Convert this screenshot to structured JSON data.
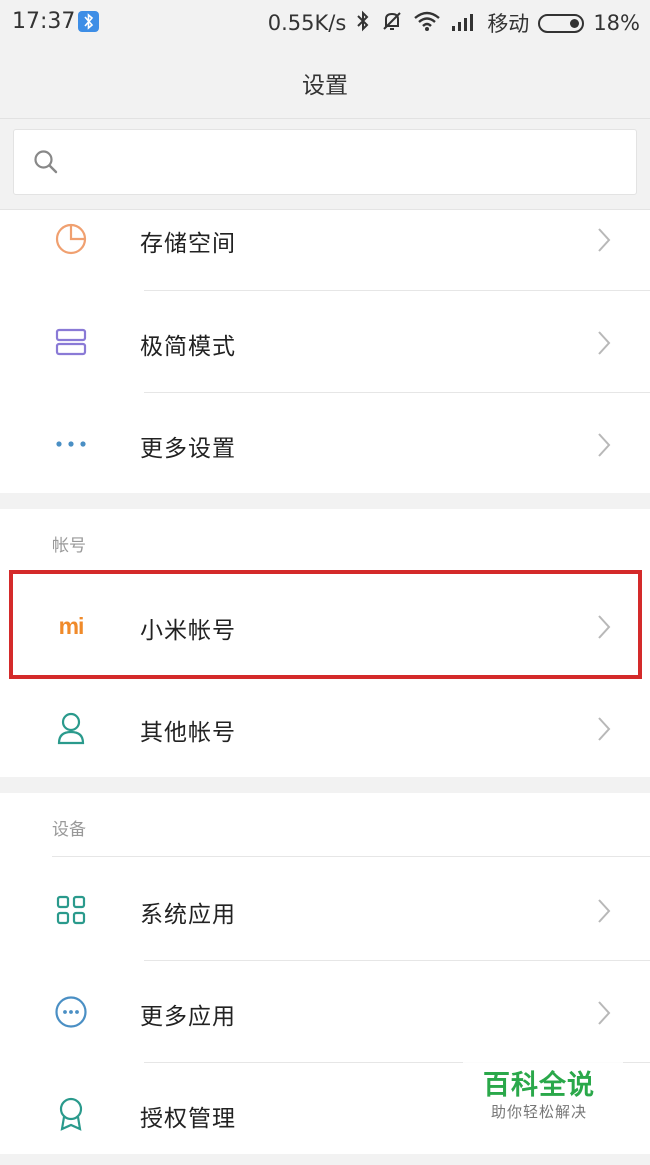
{
  "status_bar": {
    "time": "17:37",
    "speed": "0.55K/s",
    "carrier": "移动",
    "battery": "18%",
    "icons": [
      "bluetooth-app-badge",
      "bluetooth-icon",
      "mute-bell-icon",
      "wifi-icon",
      "signal-icon",
      "battery-icon"
    ]
  },
  "header": {
    "title": "设置"
  },
  "search": {
    "placeholder": "",
    "value": ""
  },
  "top_group": [
    {
      "label": "存储空间",
      "icon": "storage-pie-icon"
    },
    {
      "label": "极简模式",
      "icon": "simple-mode-icon"
    },
    {
      "label": "更多设置",
      "icon": "more-dots-icon"
    }
  ],
  "accounts": {
    "header": "帐号",
    "items": [
      {
        "label": "小米帐号",
        "icon": "mi-logo-icon",
        "logo_text": "mi"
      },
      {
        "label": "其他帐号",
        "icon": "person-icon"
      }
    ]
  },
  "device": {
    "header": "设备",
    "items": [
      {
        "label": "系统应用",
        "icon": "grid-apps-icon"
      },
      {
        "label": "更多应用",
        "icon": "more-apps-icon"
      },
      {
        "label": "授权管理",
        "icon": "authorization-icon"
      }
    ]
  },
  "watermark": {
    "title": "百科全说",
    "subtitle": "助你轻松解决"
  },
  "colors": {
    "accent_orange": "#f08a2a",
    "highlight_red": "#d42a2a",
    "teal": "#2a9a8c",
    "purple": "#8a7ad6",
    "blue": "#4a8fc4",
    "watermark_green": "#2aa84a"
  }
}
